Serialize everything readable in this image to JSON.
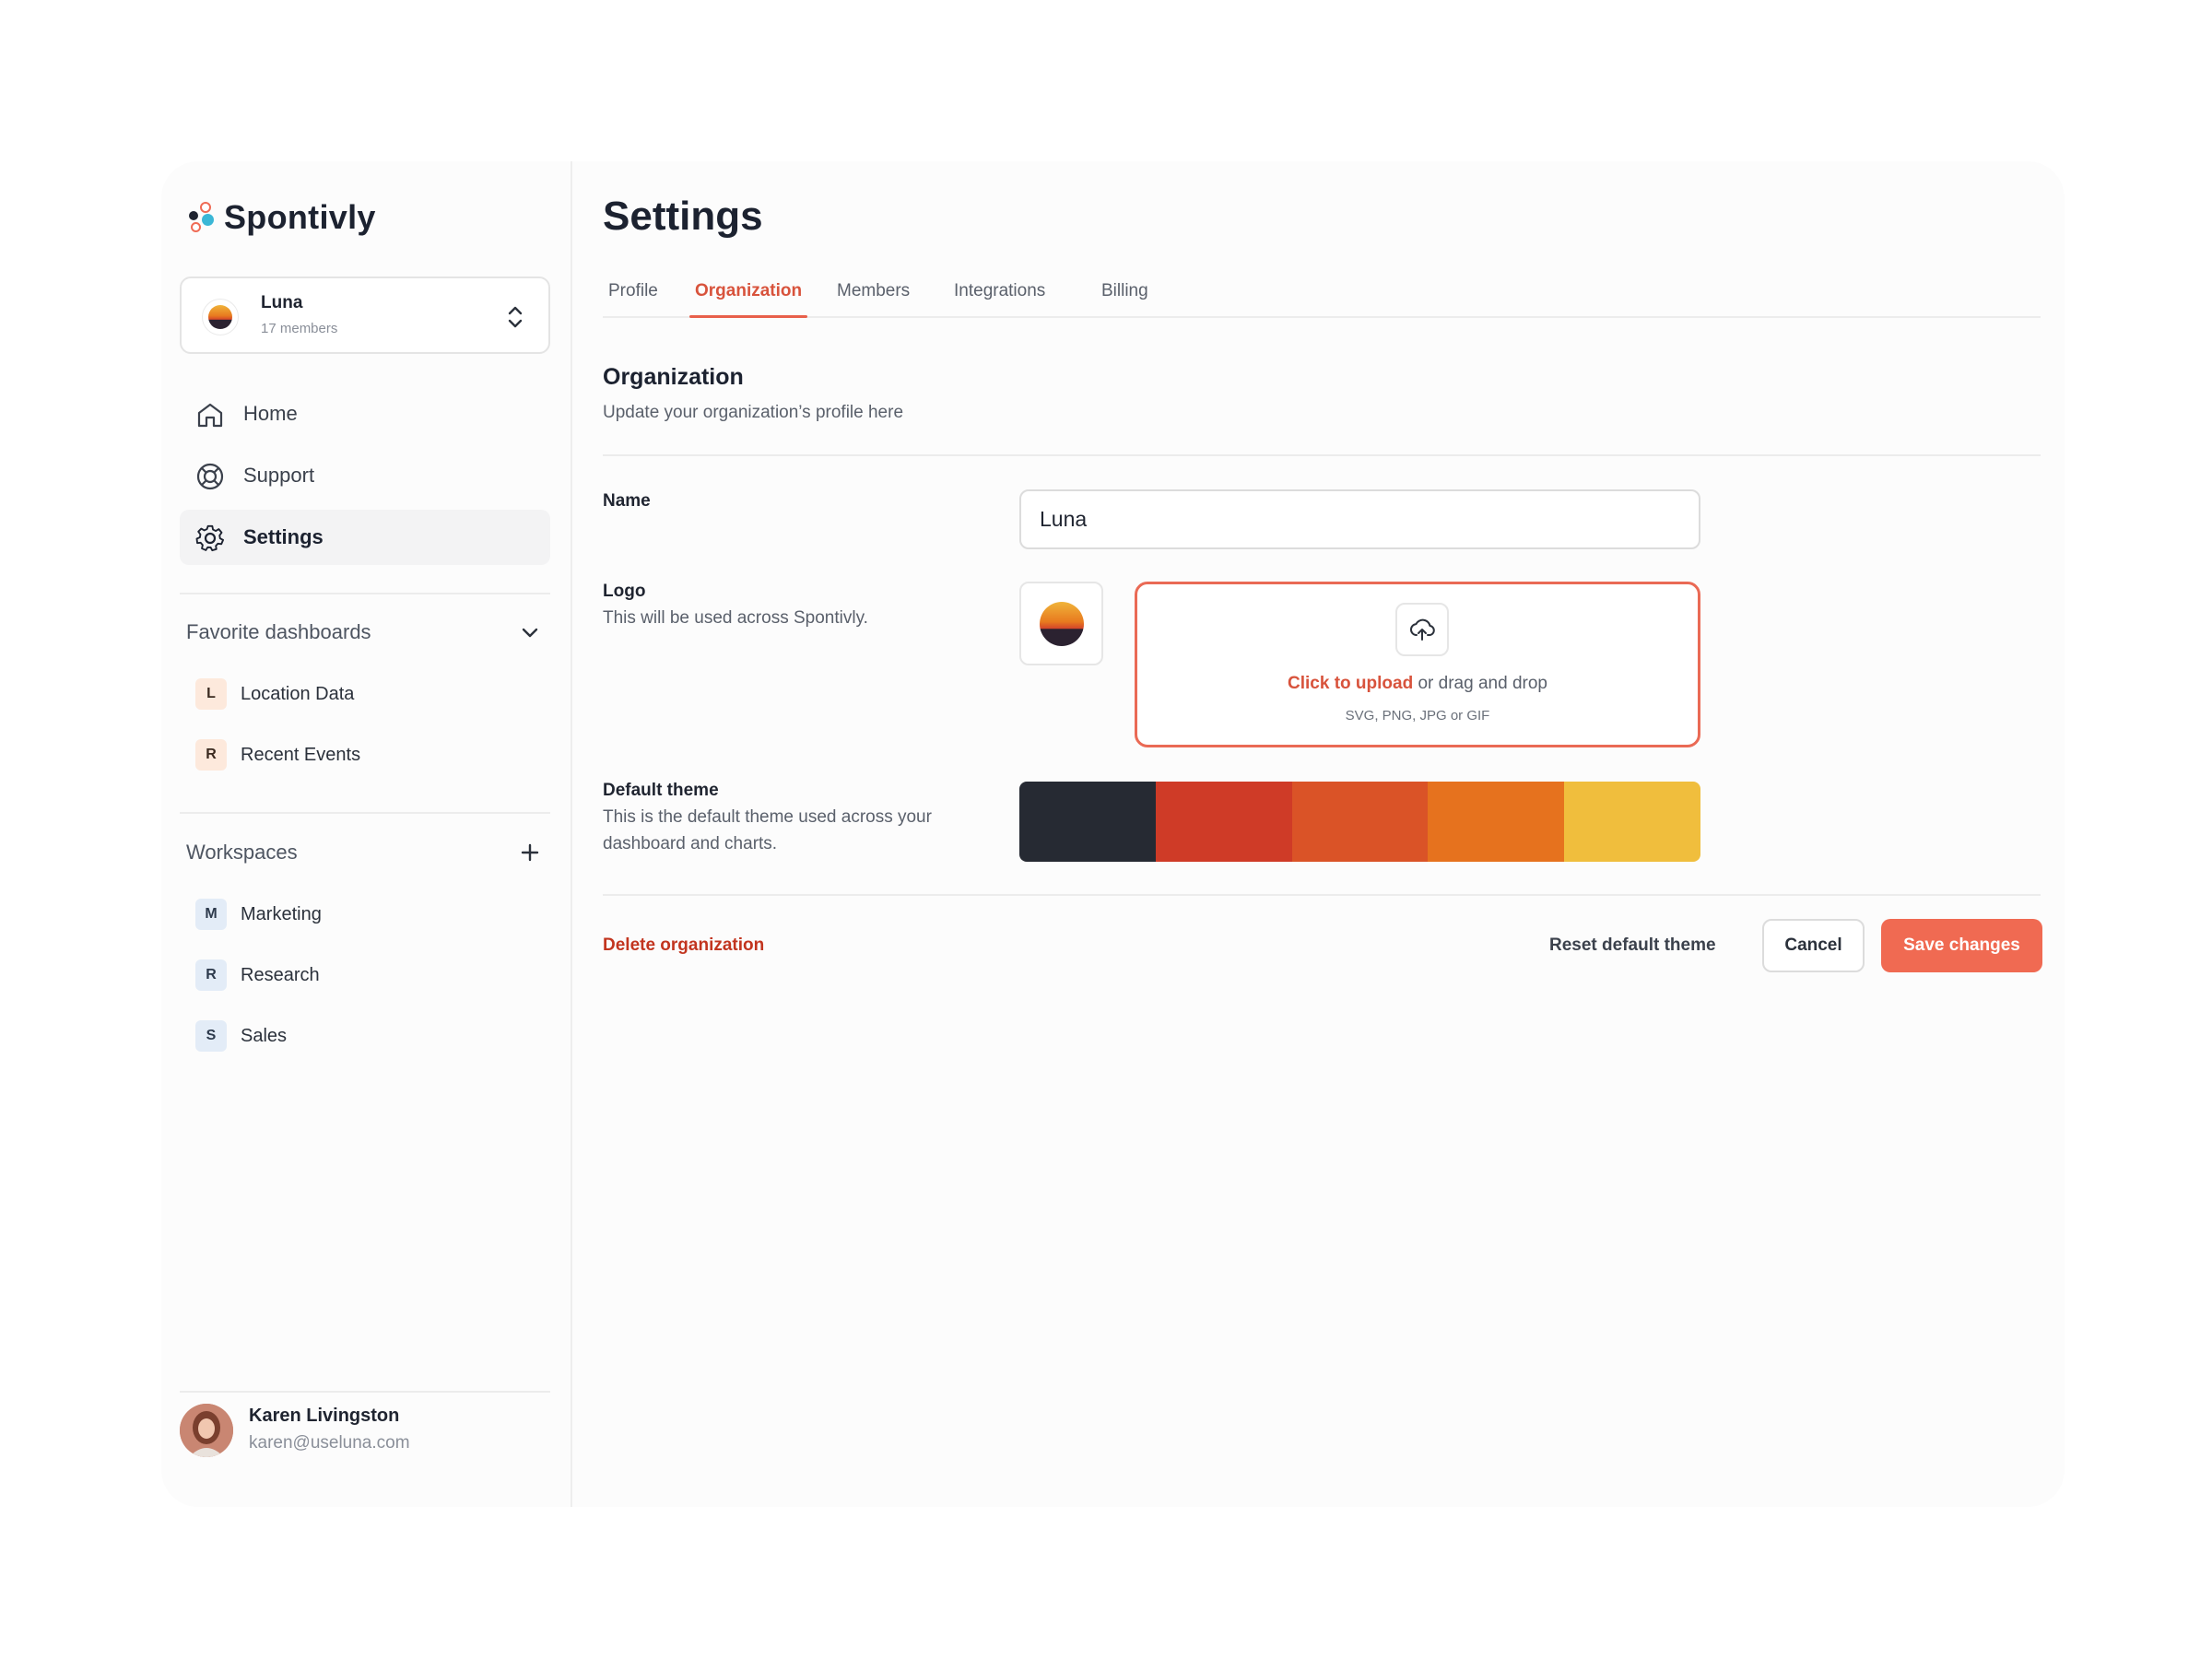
{
  "brand": {
    "name": "Spontivly",
    "colors": {
      "accent": "#f06a52",
      "link": "#d8533c",
      "danger": "#c2351f"
    }
  },
  "org_switcher": {
    "name": "Luna",
    "members": "17 members",
    "avatar_icon": "sunset-logo-icon",
    "switch_icon": "chevron-up-down-icon"
  },
  "nav": [
    {
      "label": "Home",
      "icon": "home-icon",
      "active": false
    },
    {
      "label": "Support",
      "icon": "lifebuoy-icon",
      "active": false
    },
    {
      "label": "Settings",
      "icon": "gear-icon",
      "active": true
    }
  ],
  "favorites": {
    "title": "Favorite dashboards",
    "items": [
      {
        "badge": "L",
        "label": "Location Data"
      },
      {
        "badge": "R",
        "label": "Recent Events"
      }
    ]
  },
  "workspaces": {
    "title": "Workspaces",
    "items": [
      {
        "badge": "M",
        "label": "Marketing"
      },
      {
        "badge": "R",
        "label": "Research"
      },
      {
        "badge": "S",
        "label": "Sales"
      }
    ]
  },
  "user": {
    "name": "Karen Livingston",
    "email": "karen@useluna.com"
  },
  "page": {
    "title": "Settings",
    "tabs": [
      {
        "label": "Profile",
        "active": false
      },
      {
        "label": "Organization",
        "active": true
      },
      {
        "label": "Members",
        "active": false
      },
      {
        "label": "Integrations",
        "active": false
      },
      {
        "label": "Billing",
        "active": false
      }
    ]
  },
  "organization": {
    "title": "Organization",
    "subtitle": "Update your organization’s profile here",
    "name_label": "Name",
    "name_value": "Luna",
    "logo_label": "Logo",
    "logo_help": "This will be used across Spontivly.",
    "upload_link": "Click to upload",
    "upload_rest": " or drag and drop",
    "upload_types": "SVG, PNG, JPG or GIF",
    "theme_label": "Default theme",
    "theme_help": "This is the default theme used across your dashboard and charts.",
    "theme_colors": [
      "#262a33",
      "#cf3b27",
      "#da5327",
      "#e6721e",
      "#f0be3d"
    ]
  },
  "actions": {
    "delete": "Delete organization",
    "reset": "Reset default theme",
    "cancel": "Cancel",
    "save": "Save changes"
  }
}
